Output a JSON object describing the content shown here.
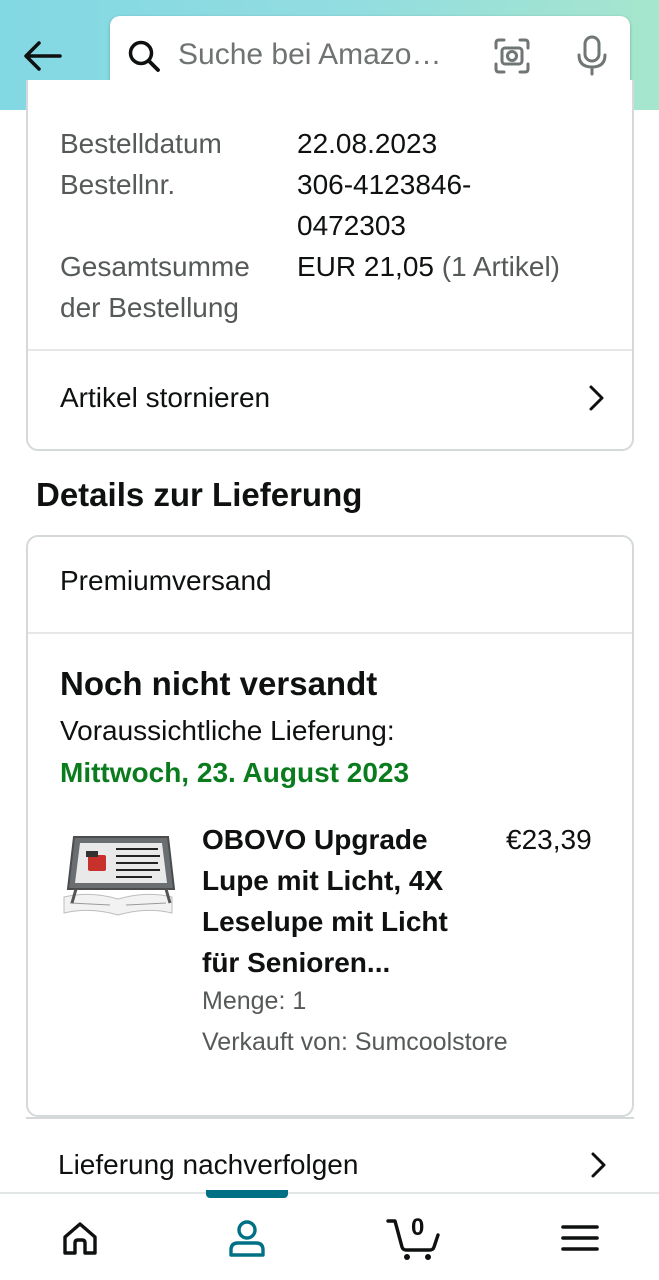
{
  "header": {
    "search_placeholder": "Suche bei Amazo…"
  },
  "order": {
    "date_label": "Bestelldatum",
    "date_value": "22.08.2023",
    "number_label": "Bestellnr.",
    "number_value_line1": "306-4123846-",
    "number_value_line2": "0472303",
    "total_label_line1": "Gesamtsumme",
    "total_label_line2": "der Bestellung",
    "total_value": "EUR 21,05",
    "total_count": "(1 Artikel)",
    "cancel_label": "Artikel stornieren"
  },
  "delivery": {
    "section_title": "Details zur Lieferung",
    "shipping_method": "Premiumversand",
    "status": "Noch nicht versandt",
    "eta_label": "Voraussichtliche Lieferung:",
    "eta_date": "Mittwoch, 23. August 2023",
    "eta_color": "#0a7c1e",
    "product": {
      "title_lines": [
        "OBOVO Upgrade",
        "Lupe mit Licht, 4X",
        "Leselupe mit Licht",
        "für Senioren..."
      ],
      "price": "€23,39",
      "quantity": "Menge: 1",
      "seller": "Verkauft von: Sumcoolstore"
    },
    "track_label": "Lieferung nachverfolgen"
  },
  "bottom_nav": {
    "items": [
      "home-icon",
      "account-icon",
      "cart-icon",
      "menu-icon"
    ],
    "cart_count": "0",
    "active_color": "#007185"
  }
}
